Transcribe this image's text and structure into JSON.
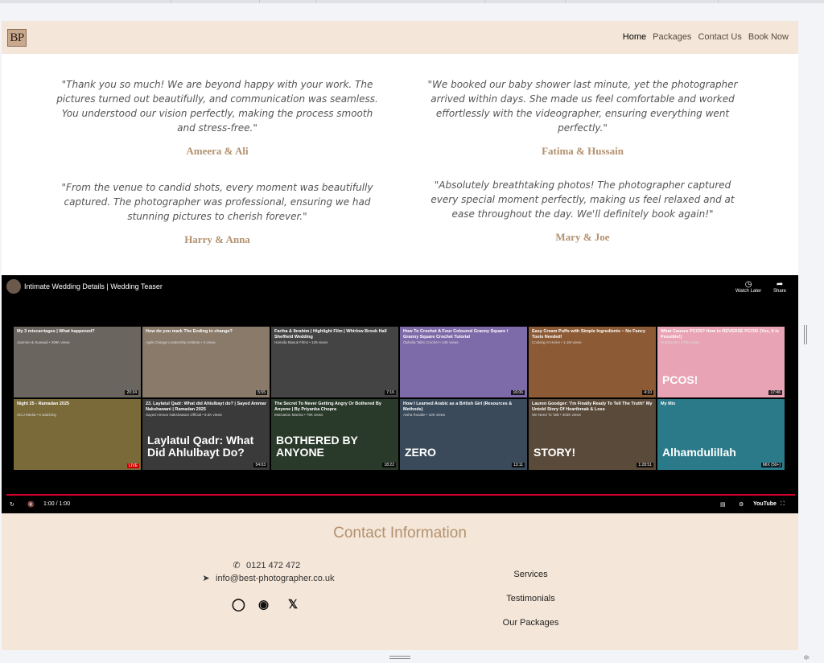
{
  "nav": {
    "logo": "BP",
    "links": [
      "Home",
      "Packages",
      "Contact Us",
      "Book Now"
    ]
  },
  "testimonials": [
    {
      "quote": "\"Thank you so much! We are beyond happy with your work. The pictures turned out beautifully, and communication was seamless. You understood our vision perfectly, making the process smooth and stress-free.\"",
      "author": "Ameera & Ali"
    },
    {
      "quote": "\"We booked our baby shower last minute, yet the photographer arrived within days. She made us feel comfortable and worked effortlessly with the videographer, ensuring everything went perfectly.\"",
      "author": "Fatima & Hussain"
    },
    {
      "quote": "\"From the venue to candid shots, every moment was beautifully captured. The photographer was professional, ensuring we had stunning pictures to cherish forever.\"",
      "author": "Harry & Anna"
    },
    {
      "quote": "\"Absolutely breathtaking photos! The photographer captured every special moment perfectly, making us feel relaxed and at ease throughout the day. We'll definitely book again!\"",
      "author": "Mary & Joe"
    }
  ],
  "video": {
    "title": "Intimate Wedding Details | Wedding Teaser",
    "watch_later": "Watch Later",
    "share": "Share",
    "time": "1:00 / 1:00",
    "brand": "YouTube",
    "tiles": [
      {
        "title": "My 3 miscarriages | What happened?",
        "sub": "Jasmine & Suwaad • 299K views",
        "dur": "20:34",
        "bg": "#6b6560",
        "big": ""
      },
      {
        "title": "How do you mark The Ending in change?",
        "sub": "Agile Change Leadership Institute • 3 views",
        "dur": "5:55",
        "bg": "#8a7a6a",
        "big": ""
      },
      {
        "title": "Fariha & Ibrahim | Highlight Film | Whirlow Brook Hall Sheffield Wedding",
        "sub": "Hamida Masuk Films • 129 views",
        "dur": "7:16",
        "bg": "#444444",
        "big": ""
      },
      {
        "title": "How To Crochet A Four Coloured Granny Square / Granny Square Crochet Tutorial",
        "sub": "Ophelia Talks Crochet • 14K views",
        "dur": "16:06",
        "bg": "#7d6aa8",
        "big": ""
      },
      {
        "title": "Easy Cream Puffs with Simple Ingredients ~ No Fancy Tools Needed!",
        "sub": "Cooking At Home • 1.1M views",
        "dur": "4:10",
        "bg": "#8c5a34",
        "big": ""
      },
      {
        "title": "What Causes PCOS? How to REVERSE PCOS! (Yes, It Is Possible!)",
        "sub": "Nutritionist • 279K views",
        "dur": "17:46",
        "bg": "#e8a3b5",
        "big": "PCOS!"
      },
      {
        "title": "Night 25 - Ramadan 2025",
        "sub": "ISCJ Media • 6 watching",
        "dur": "",
        "bg": "#7a6a3a",
        "big": "",
        "live": "LIVE"
      },
      {
        "title": "23. Laylatul Qadr: What did Ahlulbayt do? | Sayed Ammar Nakshawani | Ramadan 2025",
        "sub": "Sayed Ammar Nakshawani Official • 9.2K views",
        "dur": "54:03",
        "bg": "#3a3a3a",
        "big": "Laylatul Qadr: What Did Ahlulbayt Do?"
      },
      {
        "title": "The Secret To Never Getting Angry Or Bothered By Anyone | By Priyanka Chopra",
        "sub": "Motivation Mantra • 79K views",
        "dur": "18:22",
        "bg": "#2a3a2a",
        "big": "BOTHERED BY ANYONE"
      },
      {
        "title": "How I Learned Arabic as a British Girl (Resources & Methods)",
        "sub": "Aisha Rosalie • 10K views",
        "dur": "13:11",
        "bg": "#3a4a5a",
        "big": "ZERO"
      },
      {
        "title": "Lauren Goodger: 'I'm Finally Ready To Tell The Truth!' My Untold Story Of Heartbreak & Loss",
        "sub": "We Need To Talk • 303K views",
        "dur": "1:28:51",
        "bg": "#5a4a3a",
        "big": "STORY!"
      },
      {
        "title": "My Mix",
        "sub": "",
        "dur": "MIX (50+)",
        "bg": "#2a7a8a",
        "big": "Alhamdulillah"
      }
    ]
  },
  "contact": {
    "title": "Contact Information",
    "phone": "0121 472 472",
    "email": "info@best-photographer.co.uk",
    "links": [
      "Services",
      "Testimonials",
      "Our Packages"
    ]
  },
  "colors": {
    "nav_bg": "#f4e6d8",
    "accent": "#b3916f",
    "progress": "#d3002d"
  }
}
